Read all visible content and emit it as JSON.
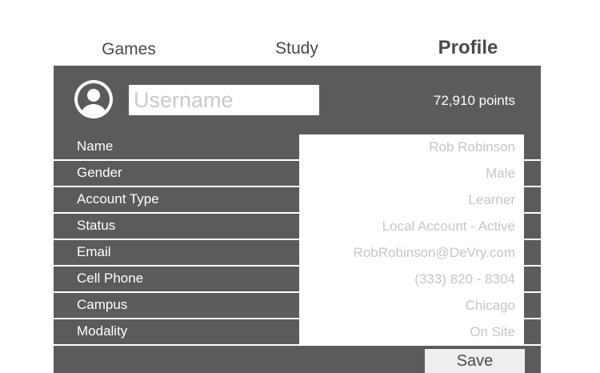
{
  "nav": {
    "tabs": [
      {
        "label": "Games"
      },
      {
        "label": "Study"
      },
      {
        "label": "Profile"
      }
    ],
    "active": "Profile"
  },
  "profile": {
    "username_placeholder": "Username",
    "points": "72,910 points",
    "avatar_icon": "user-avatar-icon",
    "fields": [
      {
        "label": "Name",
        "value": "Rob Robinson"
      },
      {
        "label": "Gender",
        "value": "Male"
      },
      {
        "label": "Account Type",
        "value": "Learner"
      },
      {
        "label": "Status",
        "value": "Local Account - Active"
      },
      {
        "label": "Email",
        "value": "RobRobinson@DeVry.com"
      },
      {
        "label": "Cell Phone",
        "value": "(333) 820 - 8304"
      },
      {
        "label": "Campus",
        "value": "Chicago"
      },
      {
        "label": "Modality",
        "value": "On Site"
      }
    ],
    "save_label": "Save"
  },
  "colors": {
    "panel": "#5b5b5b",
    "field_bg": "#ffffff",
    "field_text": "#c6c6c6",
    "save_bg": "#eeeeee"
  }
}
